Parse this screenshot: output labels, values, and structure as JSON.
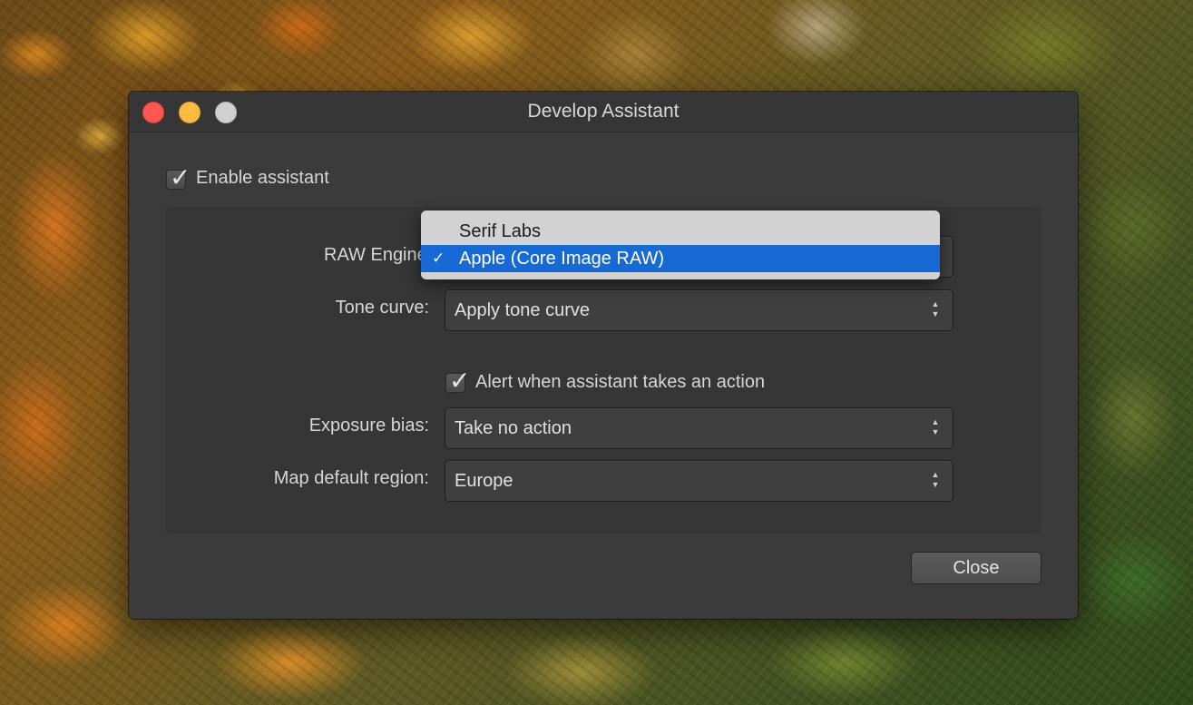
{
  "window": {
    "title": "Develop Assistant"
  },
  "enable_assistant": {
    "label": "Enable assistant",
    "checked": true
  },
  "raw_engine": {
    "label": "RAW Engine",
    "menu_options": [
      {
        "label": "Serif Labs",
        "selected": false
      },
      {
        "label": "Apple (Core Image RAW)",
        "selected": true
      }
    ],
    "tick": "✓"
  },
  "tone_curve": {
    "label": "Tone curve:",
    "value": "Apply tone curve"
  },
  "alert": {
    "label": "Alert when assistant takes an action",
    "checked": true
  },
  "exposure_bias": {
    "label": "Exposure bias:",
    "value": "Take no action"
  },
  "map_region": {
    "label": "Map default region:",
    "value": "Europe"
  },
  "buttons": {
    "close": "Close"
  },
  "icons": {
    "checkmark": "✓",
    "popup_arrows_up": "▲",
    "popup_arrows_down": "▼"
  },
  "colors": {
    "selection_blue": "#1769d6",
    "traffic_close": "#fc5753",
    "traffic_minimize": "#fdbc40",
    "traffic_zoom_inactive": "#d0d0d0"
  }
}
